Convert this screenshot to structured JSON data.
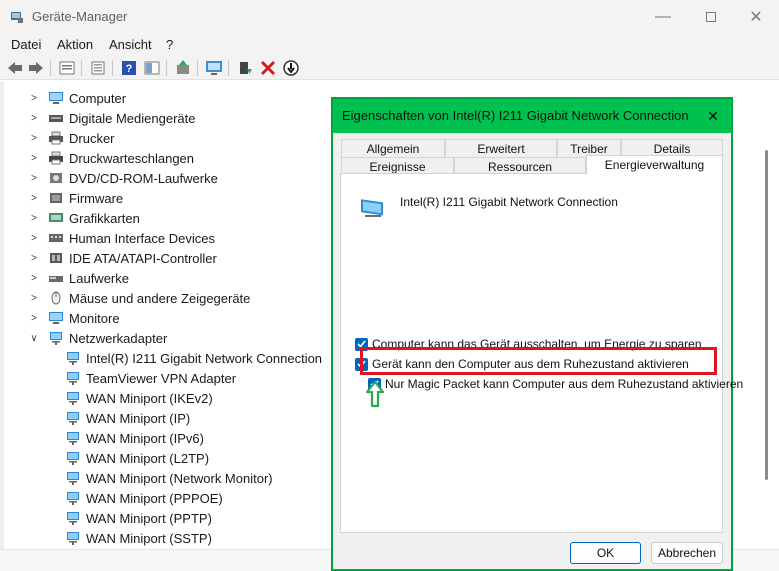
{
  "window": {
    "title": "Geräte-Manager"
  },
  "menu": [
    "Datei",
    "Aktion",
    "Ansicht",
    "?"
  ],
  "tree": {
    "categories": [
      {
        "label": "Computer",
        "icon": "computer-icon"
      },
      {
        "label": "Digitale Mediengeräte",
        "icon": "media-device-icon"
      },
      {
        "label": "Drucker",
        "icon": "printer-icon"
      },
      {
        "label": "Druckwarteschlangen",
        "icon": "print-queue-icon"
      },
      {
        "label": "DVD/CD-ROM-Laufwerke",
        "icon": "optical-drive-icon"
      },
      {
        "label": "Firmware",
        "icon": "firmware-icon"
      },
      {
        "label": "Grafikkarten",
        "icon": "display-adapter-icon"
      },
      {
        "label": "Human Interface Devices",
        "icon": "hid-icon"
      },
      {
        "label": "IDE ATA/ATAPI-Controller",
        "icon": "ide-controller-icon"
      },
      {
        "label": "Laufwerke",
        "icon": "disk-drive-icon"
      },
      {
        "label": "Mäuse und andere Zeigegeräte",
        "icon": "mouse-icon"
      },
      {
        "label": "Monitore",
        "icon": "monitor-icon"
      },
      {
        "label": "Netzwerkadapter",
        "icon": "network-adapter-icon"
      }
    ],
    "network_children": [
      "Intel(R) I211 Gigabit Network Connection",
      "TeamViewer VPN Adapter",
      "WAN Miniport (IKEv2)",
      "WAN Miniport (IP)",
      "WAN Miniport (IPv6)",
      "WAN Miniport (L2TP)",
      "WAN Miniport (Network Monitor)",
      "WAN Miniport (PPPOE)",
      "WAN Miniport (PPTP)",
      "WAN Miniport (SSTP)"
    ]
  },
  "dialog": {
    "title": "Eigenschaften von Intel(R) I211 Gigabit Network Connection",
    "tabs_row1": [
      "Allgemein",
      "Erweitert",
      "Treiber",
      "Details"
    ],
    "tabs_row2": [
      "Ereignisse",
      "Ressourcen",
      "Energieverwaltung"
    ],
    "active_tab": "Energieverwaltung",
    "device_name": "Intel(R) I211 Gigabit Network Connection",
    "options": [
      {
        "label": "Computer kann das Gerät ausschalten, um Energie zu sparen",
        "checked": true
      },
      {
        "label": "Gerät kann den Computer aus dem Ruhezustand aktivieren",
        "checked": true
      },
      {
        "label": "Nur Magic Packet kann Computer aus dem Ruhezustand aktivieren",
        "checked": true
      }
    ],
    "ok_label": "OK",
    "cancel_label": "Abbrechen"
  },
  "colors": {
    "accent": "#0067c0",
    "highlight": "#e0141e",
    "arrow": "#2fa84f",
    "dialog_frame": "#00c050"
  }
}
